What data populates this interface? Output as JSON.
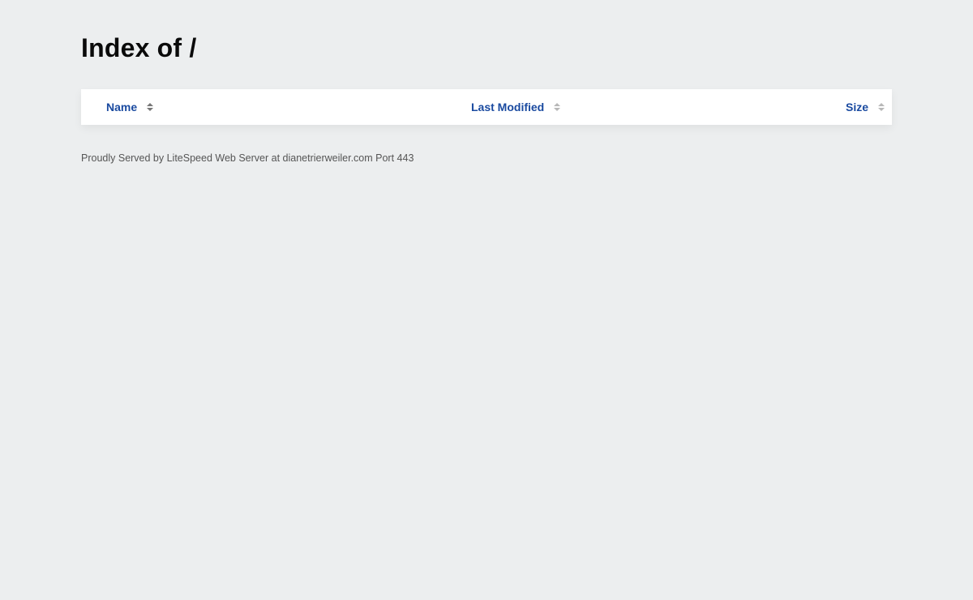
{
  "page": {
    "title": "Index of /"
  },
  "table": {
    "columns": [
      {
        "label": "Name",
        "sort_icon": "sort-icon"
      },
      {
        "label": "Last Modified",
        "sort_icon": "sort-icon"
      },
      {
        "label": "Size",
        "sort_icon": "sort-icon"
      }
    ],
    "rows": []
  },
  "footer": {
    "text": "Proudly Served by LiteSpeed Web Server at dianetrierweiler.com Port 443"
  },
  "colors": {
    "background": "#eceeef",
    "header_link": "#1a4aa0",
    "panel": "#ffffff"
  }
}
